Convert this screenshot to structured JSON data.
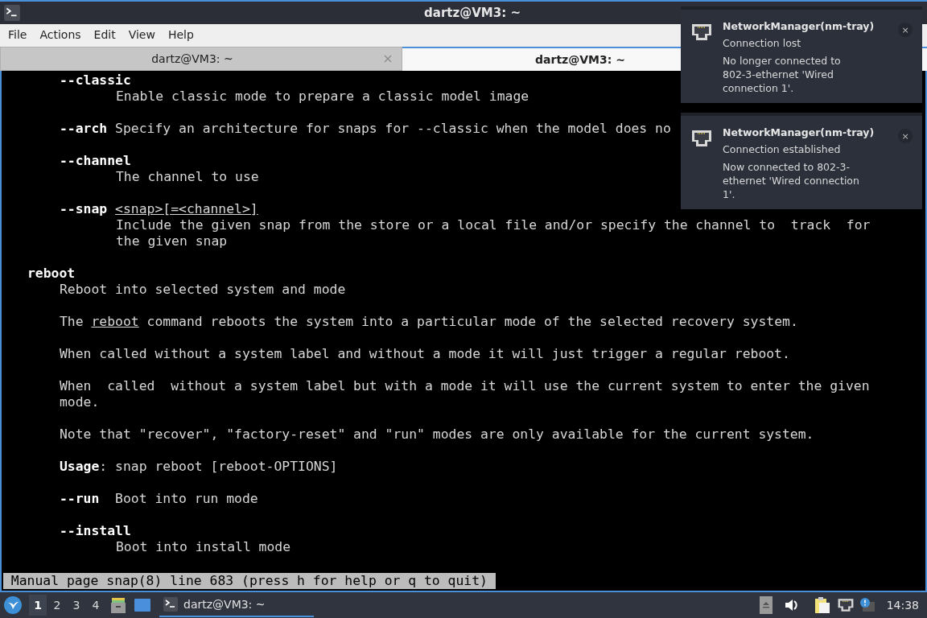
{
  "window": {
    "title": "dartz@VM3: ~"
  },
  "menu": [
    "File",
    "Actions",
    "Edit",
    "View",
    "Help"
  ],
  "tabs": [
    {
      "label": "dartz@VM3: ~",
      "selected": false,
      "closable": true
    },
    {
      "label": "dartz@VM3: ~",
      "selected": true,
      "closable": false
    }
  ],
  "terminal": {
    "blocks": [
      {
        "lines": [
          {
            "kind": "option",
            "segments": [
              {
                "text": "--classic",
                "kind": "bold"
              }
            ]
          },
          {
            "kind": "description",
            "segments": [
              {
                "text": "Enable classic mode to prepare a classic model image",
                "kind": "plain"
              }
            ]
          }
        ]
      },
      {
        "lines": [
          {
            "kind": "option",
            "segments": [
              {
                "text": "--arch ",
                "kind": "bold"
              },
              {
                "text": "Specify an architecture for snaps for --classic when the model does no",
                "kind": "plain"
              }
            ]
          }
        ]
      },
      {
        "lines": [
          {
            "kind": "option",
            "segments": [
              {
                "text": "--channel",
                "kind": "bold"
              }
            ]
          },
          {
            "kind": "description",
            "segments": [
              {
                "text": "The channel to use",
                "kind": "plain"
              }
            ]
          }
        ]
      },
      {
        "lines": [
          {
            "kind": "option",
            "segments": [
              {
                "text": "--snap ",
                "kind": "bold"
              },
              {
                "text": "<snap>[=<channel>]",
                "kind": "underline"
              }
            ]
          },
          {
            "kind": "description",
            "segments": [
              {
                "text": "Include the given snap from the store or a local file and/or specify the channel to  track  for",
                "kind": "plain"
              }
            ]
          },
          {
            "kind": "description",
            "segments": [
              {
                "text": "the given snap",
                "kind": "plain"
              }
            ]
          }
        ]
      },
      {
        "lines": [
          {
            "kind": "section",
            "segments": [
              {
                "text": "reboot",
                "kind": "bold"
              }
            ]
          },
          {
            "kind": "paragraph",
            "segments": [
              {
                "text": "Reboot into selected system and mode",
                "kind": "plain"
              }
            ]
          }
        ]
      },
      {
        "lines": [
          {
            "kind": "paragraph",
            "segments": [
              {
                "text": "The ",
                "kind": "plain"
              },
              {
                "text": "reboot",
                "kind": "underline"
              },
              {
                "text": " command reboots the system into a particular mode of the selected recovery system.",
                "kind": "plain"
              }
            ]
          }
        ]
      },
      {
        "lines": [
          {
            "kind": "paragraph",
            "segments": [
              {
                "text": "When called without a system label and without a mode it will just trigger a regular reboot.",
                "kind": "plain"
              }
            ]
          }
        ]
      },
      {
        "lines": [
          {
            "kind": "paragraph",
            "segments": [
              {
                "text": "When  called  without a system label but with a mode it will use the current system to enter the given",
                "kind": "plain"
              }
            ]
          },
          {
            "kind": "paragraph",
            "segments": [
              {
                "text": "mode.",
                "kind": "plain"
              }
            ]
          }
        ]
      },
      {
        "lines": [
          {
            "kind": "paragraph",
            "segments": [
              {
                "text": "Note that \"recover\", \"factory-reset\" and \"run\" modes are only available for the current system.",
                "kind": "plain"
              }
            ]
          }
        ]
      },
      {
        "lines": [
          {
            "kind": "paragraph",
            "segments": [
              {
                "text": "Usage",
                "kind": "bold"
              },
              {
                "text": ": snap reboot [reboot-OPTIONS]",
                "kind": "plain"
              }
            ]
          }
        ]
      },
      {
        "lines": [
          {
            "kind": "paragraph",
            "segments": [
              {
                "text": "--run ",
                "kind": "bold"
              },
              {
                "text": " Boot into run mode",
                "kind": "plain"
              }
            ]
          }
        ]
      },
      {
        "lines": [
          {
            "kind": "paragraph",
            "segments": [
              {
                "text": "--install",
                "kind": "bold"
              }
            ]
          },
          {
            "kind": "description",
            "segments": [
              {
                "text": "Boot into install mode",
                "kind": "plain"
              }
            ]
          }
        ]
      }
    ],
    "status": " Manual page snap(8) line 683 (press h for help or q to quit)"
  },
  "taskbar": {
    "workspaces": [
      {
        "label": "1",
        "selected": true
      },
      {
        "label": "2",
        "selected": false
      },
      {
        "label": "3",
        "selected": false
      },
      {
        "label": "4",
        "selected": false
      }
    ],
    "task": {
      "label": "dartz@VM3: ~",
      "selected": true
    },
    "clock": "14:38"
  },
  "notifications": [
    {
      "app": "NetworkManager(nm-tray)",
      "summary": "Connection lost",
      "body": "No longer connected to 802-3-ethernet 'Wired connection 1'.",
      "close": "×"
    },
    {
      "app": "NetworkManager(nm-tray)",
      "summary": "Connection established",
      "body": "Now connected to 802-3-ethernet 'Wired connection 1'.",
      "close": "×"
    }
  ]
}
